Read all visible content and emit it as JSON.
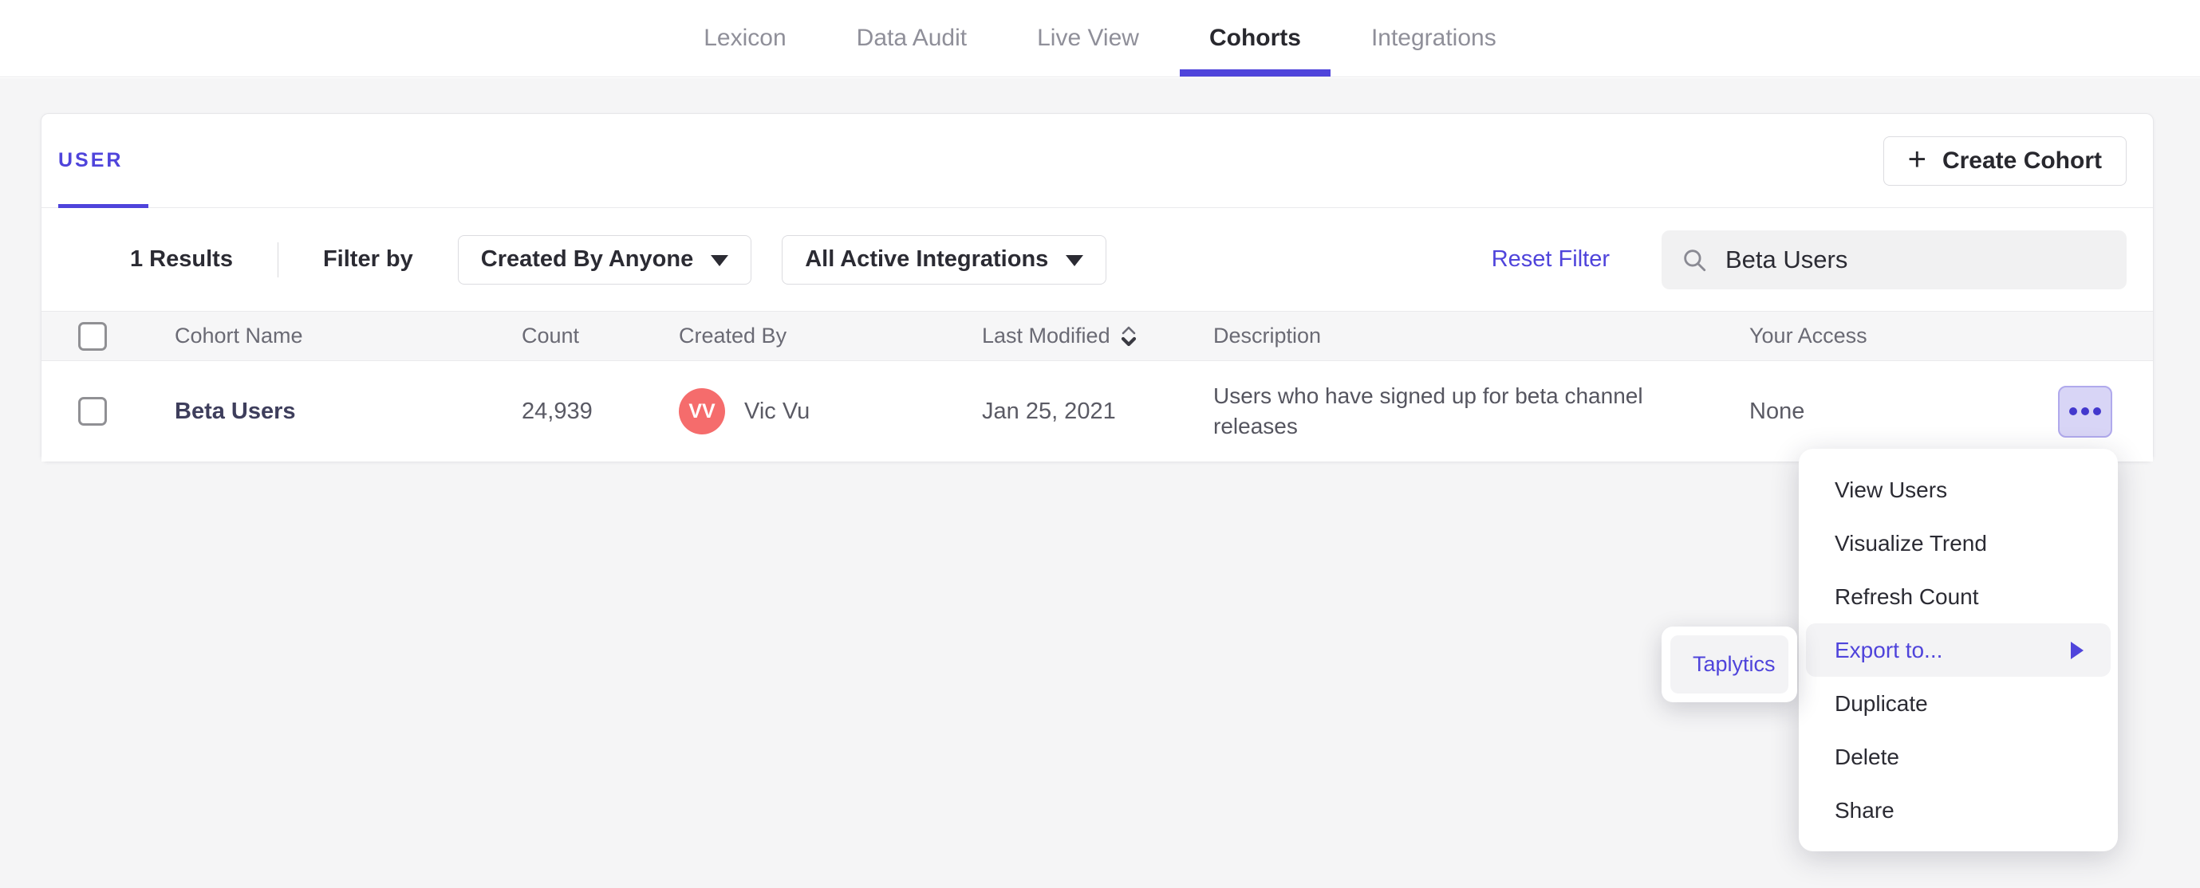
{
  "nav": {
    "tabs": [
      "Lexicon",
      "Data Audit",
      "Live View",
      "Cohorts",
      "Integrations"
    ],
    "active_tab": "Cohorts"
  },
  "card": {
    "tab_label": "USER",
    "create_button": "Create Cohort",
    "filters": {
      "results_count": "1 Results",
      "filter_by_label": "Filter by",
      "created_by_dropdown": "Created By Anyone",
      "integrations_dropdown": "All Active Integrations",
      "reset_link": "Reset Filter",
      "search_value": "Beta Users"
    },
    "table": {
      "headers": [
        "Cohort Name",
        "Count",
        "Created By",
        "Last Modified",
        "Description",
        "Your Access"
      ],
      "rows": [
        {
          "name": "Beta Users",
          "count": "24,939",
          "avatar_initials": "VV",
          "created_by": "Vic Vu",
          "last_modified": "Jan 25, 2021",
          "description": "Users who have signed up for beta channel releases",
          "access": "None"
        }
      ]
    }
  },
  "context_menu": {
    "items": [
      "View Users",
      "Visualize Trend",
      "Refresh Count",
      "Export to...",
      "Duplicate",
      "Delete",
      "Share"
    ],
    "highlighted_item": "Export to..."
  },
  "submenu": {
    "items": [
      "Taplytics"
    ]
  },
  "colors": {
    "accent_purple": "#4f44db",
    "avatar_red": "#f56c6c",
    "page_background": "#f5f5f6",
    "table_header_background": "#f6f6f7",
    "more_button_background": "#d8d5f6",
    "link_navy": "#3e3e5c"
  }
}
